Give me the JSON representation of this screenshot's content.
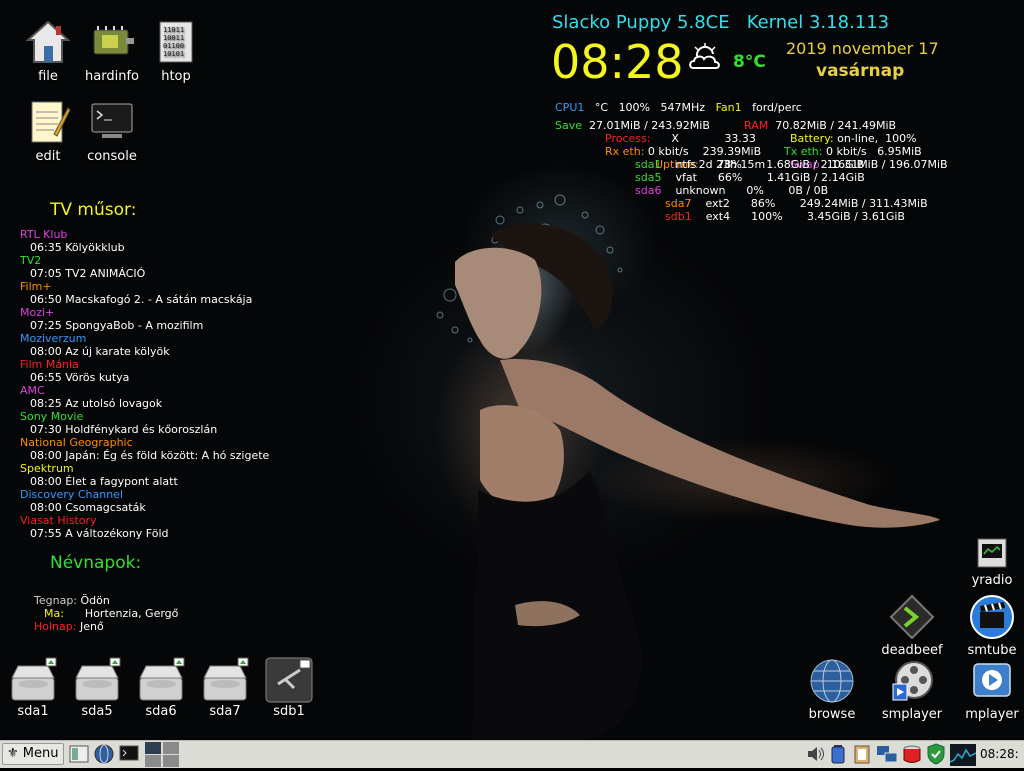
{
  "header": {
    "title": "Slacko Puppy 5.8CE",
    "kernel": "Kernel 3.18.113",
    "time": "08:28",
    "temp": "8°C",
    "date": "2019 november 17",
    "weekday": "vasárnap"
  },
  "desktop_icons": {
    "file": "file",
    "hardinfo": "hardinfo",
    "htop": "htop",
    "edit": "edit",
    "console": "console",
    "yradio": "yradio",
    "deadbeef": "deadbeef",
    "smtube": "smtube",
    "browse": "browse",
    "smplayer": "smplayer",
    "mplayer": "mplayer"
  },
  "tv": {
    "heading": "TV műsor:",
    "channels": [
      {
        "name": "RTL Klub",
        "program": "06:35 Kölyökklub",
        "color": "#e040e0"
      },
      {
        "name": "TV2",
        "program": "07:05 TV2 ANIMÁCIÓ",
        "color": "#30e030"
      },
      {
        "name": "Film+",
        "program": "06:50 Macskafogó 2. - A sátán macskája",
        "color": "#ff8c00"
      },
      {
        "name": "Mozi+",
        "program": "07:25 SpongyaBob - A mozifilm",
        "color": "#e040e0"
      },
      {
        "name": "Moziverzum",
        "program": "08:00 Az új karate kölyök",
        "color": "#3399ff"
      },
      {
        "name": "Film Mánia",
        "program": "06:55 Vörös kutya",
        "color": "#ff2020"
      },
      {
        "name": "AMC",
        "program": "08:25 Az utolsó lovagok",
        "color": "#e040e0"
      },
      {
        "name": "Sony Movie",
        "program": "07:30 Holdfénykard és kőoroszlán",
        "color": "#30e030"
      },
      {
        "name": "National Geographic",
        "program": "08:00 Japán: Ég és föld között: A hó szigete",
        "color": "#ff8c00"
      },
      {
        "name": "Spektrum",
        "program": "08:00 Élet a fagypont alatt",
        "color": "#f0f020"
      },
      {
        "name": "Discovery Channel",
        "program": "08:00 Csomagcsaták",
        "color": "#3399ff"
      },
      {
        "name": "Viasat History",
        "program": "07:55 A változékony Föld",
        "color": "#ff2020"
      }
    ]
  },
  "names": {
    "heading": "Névnapok:",
    "yesterday_label": "Tegnap:",
    "yesterday": "Ödön",
    "today_label": "Ma:",
    "today": "Hortenzia, Gergő",
    "tomorrow_label": "Holnap:",
    "tomorrow": "Jenő"
  },
  "sys": {
    "cpu_label": "CPU1",
    "cpu_temp": "°C",
    "cpu_load": "100%",
    "cpu_freq": "547MHz",
    "fan_label": "Fan1",
    "fan_val": "ford/perc",
    "save_label": "Save",
    "save_val": "27.01MiB / 243.92MiB",
    "ram_label": "RAM",
    "ram_val": "70.82MiB / 241.49MiB",
    "process_label": "Process:",
    "process_name": "X",
    "process_val": "33.33",
    "battery_label": "Battery:",
    "battery_val": "on-line,",
    "battery_pct": "100%",
    "rx_label": "Rx eth:",
    "rx_rate": "0 kbit/s",
    "rx_total": "239.39MiB",
    "tx_label": "Tx eth:",
    "tx_rate": "0 kbit/s",
    "tx_total": "6.95MiB",
    "uptime_label": "Uptime:",
    "uptime_val": "2d 23h 15m",
    "swap_label": "Swap",
    "swap_val": "10.31MiB / 196.07MiB",
    "disks": [
      {
        "name": "sda1",
        "fs": "ntfs",
        "pct": "78%",
        "size": "1.68GiB / 2.16GiB",
        "color": "#30e030"
      },
      {
        "name": "sda5",
        "fs": "vfat",
        "pct": "66%",
        "size": "1.41GiB / 2.14GiB",
        "color": "#30e030"
      },
      {
        "name": "sda6",
        "fs": "unknown",
        "pct": "0%",
        "size": "0B / 0B",
        "color": "#e040e0"
      },
      {
        "name": "sda7",
        "fs": "ext2",
        "pct": "86%",
        "size": "249.24MiB / 311.43MiB",
        "color": "#ff8c00"
      },
      {
        "name": "sdb1",
        "fs": "ext4",
        "pct": "100%",
        "size": "3.45GiB / 3.61GiB",
        "color": "#ff2020"
      }
    ]
  },
  "drives": [
    "sda1",
    "sda5",
    "sda6",
    "sda7",
    "sdb1"
  ],
  "taskbar": {
    "menu_label": "Menu",
    "clock": "08:28:"
  },
  "colors": {
    "title_cyan": "#33ddee",
    "clock_yellow": "#f5f520",
    "label_cyan": "#3399ff",
    "green": "#30e030",
    "orange": "#ff8c00",
    "red": "#ff2020",
    "magenta": "#e040e0"
  }
}
